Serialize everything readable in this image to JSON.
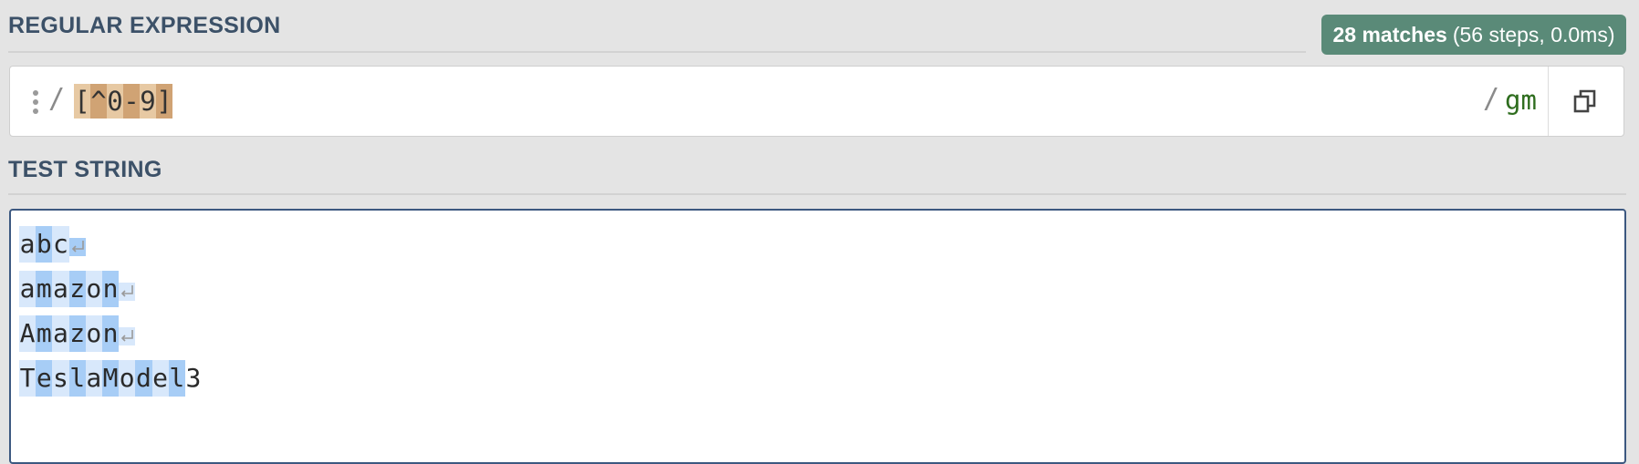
{
  "regex_section": {
    "label": "REGULAR EXPRESSION",
    "match_info": {
      "count_text": "28 matches",
      "detail_text": "(56 steps, 0.0ms)",
      "badge_color": "#5a8a78"
    },
    "delimiter_open": "/",
    "pattern_tokens": [
      "[",
      "^",
      "0",
      "-",
      "9",
      "]"
    ],
    "delimiter_close": "/",
    "flags": "gm",
    "icons": [
      "drag-handle-icon",
      "copy-icon"
    ]
  },
  "test_section": {
    "label": "TEST STRING",
    "lines": [
      "abc",
      "amazon",
      "Amazon",
      "TeslaModel3"
    ],
    "icons": [
      "newline-icon"
    ]
  },
  "colors": {
    "pattern_highlight_light": "#e7c9a3",
    "pattern_highlight_dark": "#d0a374",
    "match_light": "#d8e8fb",
    "match_dark": "#a7cdf6",
    "flags": "#2e6d1e",
    "section_label": "#3c5168"
  }
}
